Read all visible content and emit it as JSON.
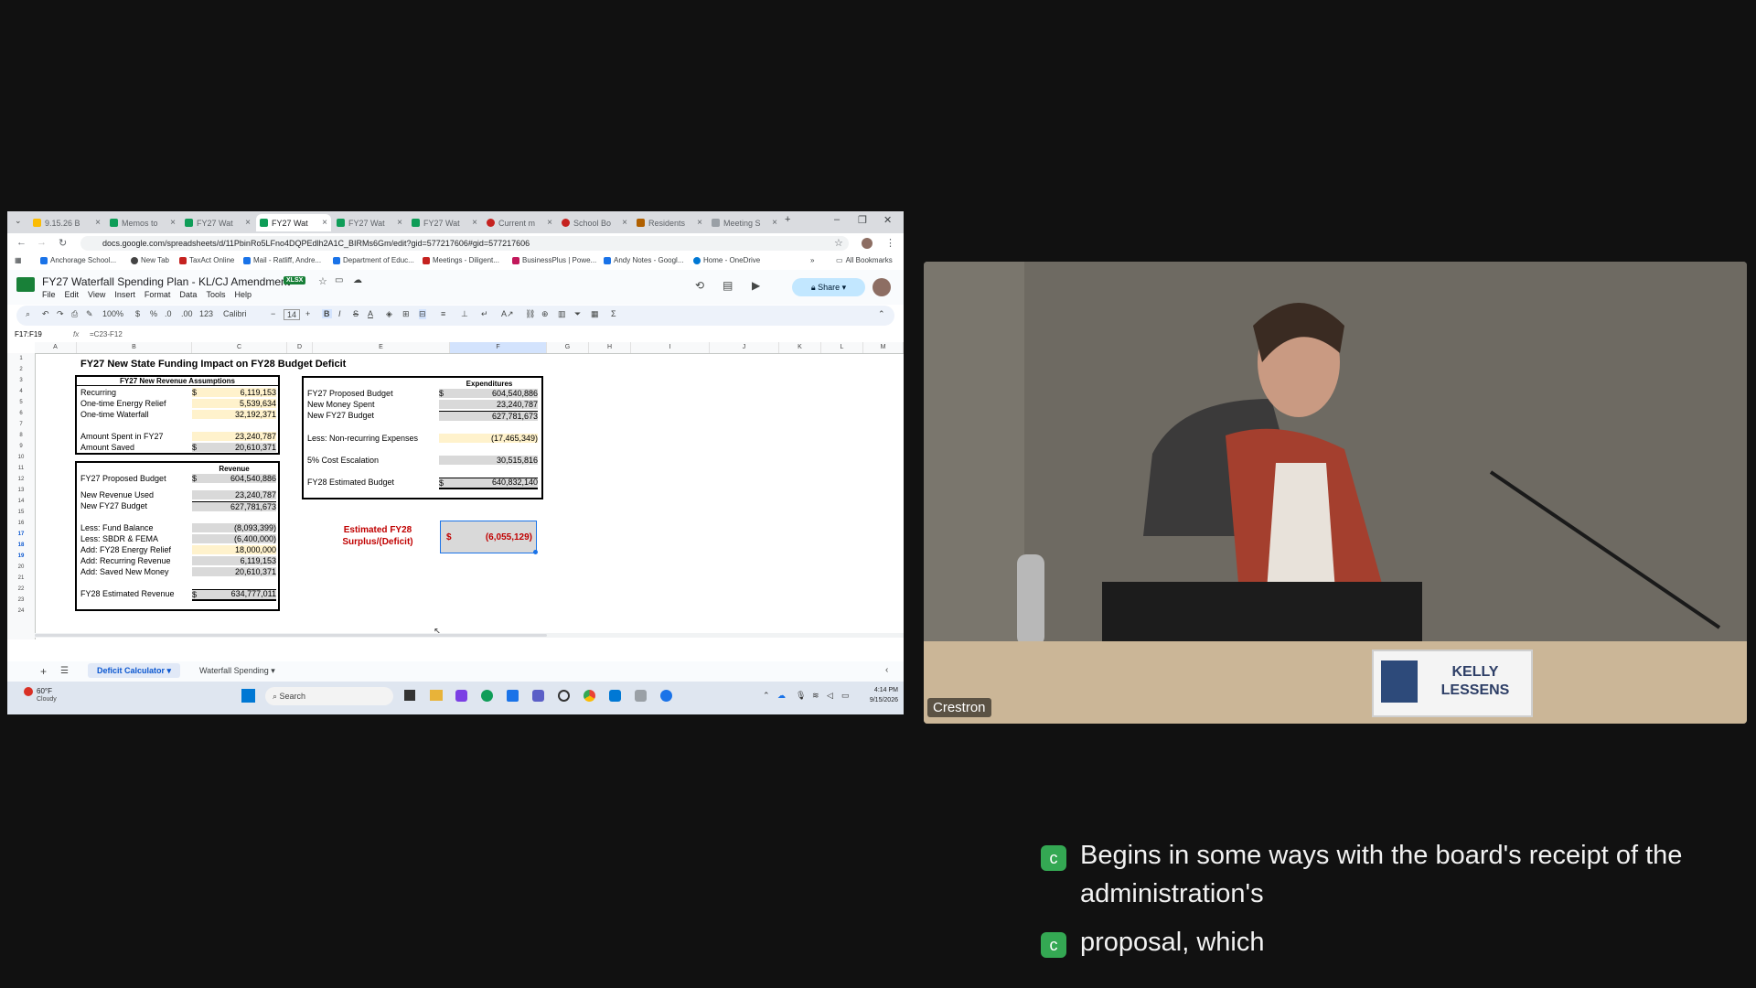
{
  "browser": {
    "tabs": [
      "9.15.26 B",
      "Memos to",
      "FY27 Wat",
      "FY27 Wat",
      "FY27 Wat",
      "FY27 Wat",
      "Current m",
      "School Bo",
      "Residents",
      "Meeting S"
    ],
    "url": "docs.google.com/spreadsheets/d/11PbinRo5LFno4DQPEdlh2A1C_BIRMs6Gm/edit?gid=577217606#gid=577217606",
    "bookmarks": [
      "Anchorage School...",
      "New Tab",
      "TaxAct Online",
      "Mail - Ratliff, Andre...",
      "Department of Educ...",
      "Meetings - Diligent...",
      "BusinessPlus | Powe...",
      "Andy Notes - Googl...",
      "Home - OneDrive"
    ],
    "all_bookmarks": "All Bookmarks"
  },
  "sheets": {
    "title": "FY27 Waterfall Spending Plan - KL/CJ Amendment",
    "badge": "XLSX",
    "menus": [
      "File",
      "Edit",
      "View",
      "Insert",
      "Format",
      "Data",
      "Tools",
      "Help"
    ],
    "share": "Share",
    "toolbar": {
      "zoom": "100%",
      "currency": "$",
      "percent": "%",
      "decimals_dec": ".0",
      "decimals_inc": ".00",
      "format": "123",
      "font": "Calibri",
      "font_size": "14"
    },
    "name_box": "F17:F19",
    "formula": "=C23-F12",
    "columns": [
      "A",
      "B",
      "C",
      "D",
      "E",
      "F",
      "G",
      "H",
      "I",
      "J",
      "K",
      "L",
      "M"
    ],
    "rows": [
      "1",
      "2",
      "3",
      "4",
      "5",
      "6",
      "7",
      "8",
      "9",
      "10",
      "11",
      "12",
      "13",
      "14",
      "15",
      "16",
      "17",
      "18",
      "19",
      "20",
      "21",
      "22",
      "23",
      "24"
    ],
    "sheet_title": "FY27 New State Funding Impact on FY28 Budget Deficit",
    "assumptions": {
      "header": "FY27 New Revenue Assumptions",
      "rows": [
        {
          "label": "Recurring",
          "dollar": "$",
          "value": "6,119,153"
        },
        {
          "label": "One-time Energy Relief",
          "dollar": "",
          "value": "5,539,634"
        },
        {
          "label": "One-time Waterfall",
          "dollar": "",
          "value": "32,192,371"
        },
        {
          "label": "Amount Spent in FY27",
          "dollar": "",
          "value": "23,240,787"
        },
        {
          "label": "Amount Saved",
          "dollar": "$",
          "value": "20,610,371"
        }
      ]
    },
    "revenue": {
      "header": "Revenue",
      "rows": [
        {
          "label": "FY27 Proposed Budget",
          "dollar": "$",
          "value": "604,540,886"
        },
        {
          "label": "New Revenue Used",
          "dollar": "",
          "value": "23,240,787"
        },
        {
          "label": "New FY27 Budget",
          "dollar": "",
          "value": "627,781,673"
        },
        {
          "label": "Less: Fund Balance",
          "dollar": "",
          "value": "(8,093,399)"
        },
        {
          "label": "Less: SBDR & FEMA",
          "dollar": "",
          "value": "(6,400,000)"
        },
        {
          "label": "Add: FY28 Energy Relief",
          "dollar": "",
          "value": "18,000,000"
        },
        {
          "label": "Add: Recurring Revenue",
          "dollar": "",
          "value": "6,119,153"
        },
        {
          "label": "Add: Saved New Money",
          "dollar": "",
          "value": "20,610,371"
        },
        {
          "label": "FY28 Estimated Revenue",
          "dollar": "$",
          "value": "634,777,011"
        }
      ]
    },
    "expenditures": {
      "header": "Expenditures",
      "rows": [
        {
          "label": "FY27 Proposed Budget",
          "dollar": "$",
          "value": "604,540,886"
        },
        {
          "label": "New Money Spent",
          "dollar": "",
          "value": "23,240,787"
        },
        {
          "label": "New FY27 Budget",
          "dollar": "",
          "value": "627,781,673"
        },
        {
          "label": "Less: Non-recurring Expenses",
          "dollar": "",
          "value": "(17,465,349)"
        },
        {
          "label": "5% Cost Escalation",
          "dollar": "",
          "value": "30,515,816"
        },
        {
          "label": "FY28 Estimated Budget",
          "dollar": "$",
          "value": "640,832,140"
        }
      ]
    },
    "surplus": {
      "label_line1": "Estimated FY28",
      "label_line2": "Surplus/(Deficit)",
      "dollar": "$",
      "value": "(6,055,129)"
    },
    "sheet_tabs": [
      "Deficit Calculator",
      "Waterfall Spending"
    ]
  },
  "taskbar": {
    "weather_temp": "60°F",
    "weather_desc": "Cloudy",
    "search": "Search",
    "time": "4:14 PM",
    "date": "9/15/2026"
  },
  "video": {
    "camera_label": "Crestron",
    "nameplate_line1": "KELLY",
    "nameplate_line2": "LESSENS"
  },
  "captions": [
    "Begins in some ways with the board's receipt of the",
    "administration's",
    "proposal, which"
  ],
  "colors": {
    "sheets_green": "#188038",
    "share_blue": "#c2e7ff",
    "deficit_red": "#c00000",
    "caption_badge": "#34a853"
  }
}
